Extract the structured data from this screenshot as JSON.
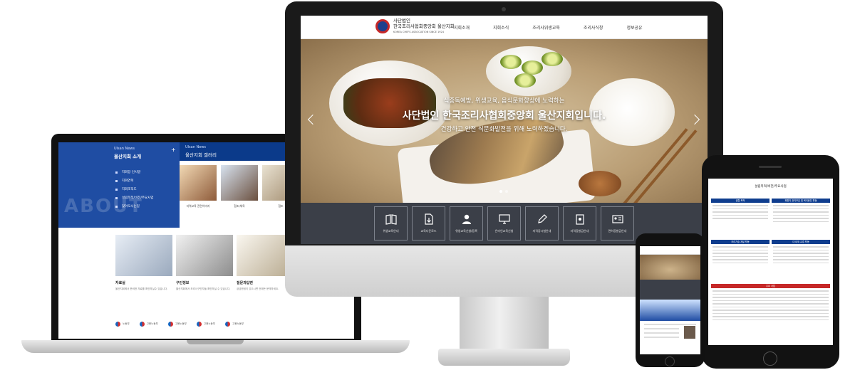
{
  "desktop": {
    "logo": {
      "line1": "사단법인",
      "line2": "한국조리사협회중앙회 울산지회",
      "line3": "KOREA CHEFS ASSOCIATION SINCE 1924"
    },
    "nav": [
      "지회소개",
      "지회소식",
      "조리사위생교육",
      "조리사식창",
      "정보공유"
    ],
    "hero": {
      "subtitle": "식중독예방, 위생교육, 음식문화향상에 노력하는",
      "title": "사단법인 한국조리사협회중앙회 울산지회입니다.",
      "desc": "건강하고 안전 식문화발전을 위해 노력하겠습니다."
    },
    "quick_links": [
      {
        "label": "위생교육안내",
        "icon": "book-icon"
      },
      {
        "label": "교육다운로드",
        "icon": "download-icon"
      },
      {
        "label": "위생교육신청/등록",
        "icon": "person-icon"
      },
      {
        "label": "온라인교육신청",
        "icon": "monitor-icon"
      },
      {
        "label": "자격증시험안내",
        "icon": "pen-icon"
      },
      {
        "label": "자격증발급안내",
        "icon": "clipboard-icon"
      },
      {
        "label": "면허증발급안내",
        "icon": "id-card-icon"
      }
    ]
  },
  "laptop": {
    "about": {
      "eyebrow": "Ulsan News",
      "title": "울산지회 소개",
      "plus": "+",
      "menu": [
        "지회장 인사말",
        "지회연혁",
        "지회조직도",
        "설립목적/비전/주요사업",
        "찾아오시는길"
      ],
      "watermark": "ABOUT"
    },
    "gallery": {
      "eyebrow": "Ulsan News",
      "title": "울산지회 갤러리",
      "plus": "+",
      "captions": [
        "지역교육 관련이미지",
        "협조/체육",
        "협조"
      ]
    },
    "cards": [
      {
        "title": "자료실",
        "desc": "울산지회에서 준비한 자료를 확인하실수 있습니다."
      },
      {
        "title": "구인정보",
        "desc": "울산지회에서 조리사구인자들 확인하실 수 있습니다."
      },
      {
        "title": "질문과답변",
        "desc": "궁금한점이 있으시면 언제든 문의하세요."
      }
    ],
    "footer_logos": [
      "노동부",
      "고용노동부",
      "고용노동부",
      "고용노동부",
      "고용노동부"
    ]
  },
  "phone_large": {
    "title": "설립목적/비전/주요사업",
    "box1": "설립 목적",
    "box2": "회원의 권익보호 및 복리증진 활동",
    "box3": "조리기술 개발 활동",
    "box4": "대 내외 교류 활동",
    "box5": "주요 사업"
  },
  "colors": {
    "brand_blue": "#0f3d8e",
    "brand_red": "#c62828",
    "quick_bar": "#3b3f48"
  }
}
